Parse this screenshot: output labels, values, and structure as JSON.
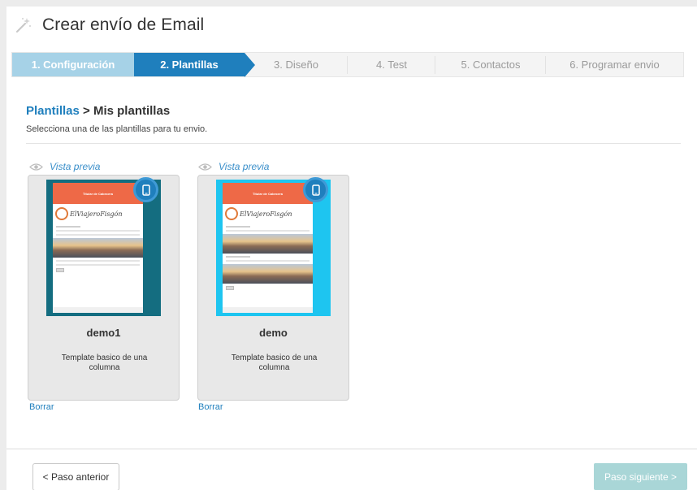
{
  "header": {
    "title": "Crear envío de Email",
    "icon": "magic-wand-icon"
  },
  "steps": [
    {
      "label": "1. Configuración",
      "state": "done"
    },
    {
      "label": "2. Plantillas",
      "state": "active"
    },
    {
      "label": "3. Diseño",
      "state": "pending"
    },
    {
      "label": "4. Test",
      "state": "pending"
    },
    {
      "label": "5. Contactos",
      "state": "pending"
    },
    {
      "label": "6. Programar envio",
      "state": "pending"
    }
  ],
  "section": {
    "breadcrumb_link": "Plantillas",
    "breadcrumb_sep": " > ",
    "breadcrumb_current": "Mis plantillas",
    "subtitle": "Selecciona una de las plantillas para tu envio."
  },
  "templates": [
    {
      "preview_label": "Vista previa",
      "name": "demo1",
      "description": "Template basico de una columna",
      "delete_label": "Borrar",
      "thumb_header": "Titular de Cabecera",
      "thumb_logo": "ElViajeroFisgón",
      "thumb_bg": "#146d80"
    },
    {
      "preview_label": "Vista previa",
      "name": "demo",
      "description": "Template basico de una columna",
      "delete_label": "Borrar",
      "thumb_header": "Titular de Cabecera",
      "thumb_logo": "ElViajeroFisgón",
      "thumb_bg": "#1ec5f0"
    }
  ],
  "footer": {
    "prev_label": "< Paso anterior",
    "next_label": "Paso siguiente >"
  },
  "colors": {
    "accent": "#1f7fbd",
    "step_done": "#a6d2e7",
    "next_disabled": "#a9d6d7"
  }
}
